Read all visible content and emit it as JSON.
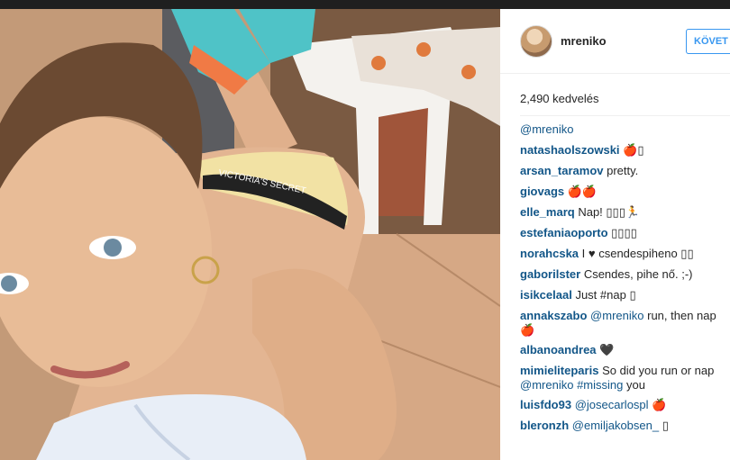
{
  "post": {
    "username": "mreniko",
    "follow_label": "KÖVET",
    "likes_text": "2,490 kedvelés",
    "caption_mention": "@mreniko"
  },
  "comments": [
    {
      "user": "natashaolszowski",
      "text": "🍎▯"
    },
    {
      "user": "arsan_taramov",
      "text": "pretty."
    },
    {
      "user": "giovags",
      "text": "🍎🍎"
    },
    {
      "user": "elle_marq",
      "text": "Nap! ▯▯▯🏃"
    },
    {
      "user": "estefaniaoporto",
      "text": "▯▯▯▯"
    },
    {
      "user": "norahcska",
      "text": "I ♥ csendespiheno ▯▯"
    },
    {
      "user": "gaborilster",
      "text": "Csendes, pihe nő. ;-)"
    },
    {
      "user": "isikcelaal",
      "text": "Just #nap ▯"
    },
    {
      "user": "annakszabo",
      "mention": "@mreniko",
      "text": "run, then nap 🍎"
    },
    {
      "user": "albanoandrea",
      "text": "🖤"
    },
    {
      "user": "mimieliteparis",
      "text": "So did you run or nap",
      "mention": "@mreniko",
      "tag": "#missing",
      "tail": "you"
    },
    {
      "user": "luisfdo93",
      "mention": "@josecarlospl",
      "text": "🍎"
    },
    {
      "user": "bleronzh",
      "mention": "@emiljakobsen_",
      "text": "▯"
    }
  ],
  "photo": {
    "waistband_text": "VICTORIA'S SECRET",
    "colors": {
      "skin": "#e3b592",
      "shirt": "#e8eef7",
      "sneaker": "#4fc3c7",
      "accent": "#3897f0",
      "username": "#125688"
    }
  }
}
